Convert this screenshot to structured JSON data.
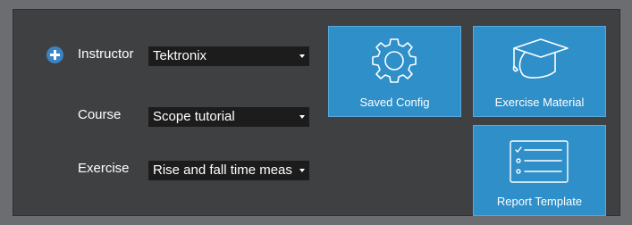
{
  "form": {
    "instructor": {
      "label": "Instructor",
      "value": "Tektronix"
    },
    "course": {
      "label": "Course",
      "value": "Scope tutorial"
    },
    "exercise": {
      "label": "Exercise",
      "value": "Rise and fall time meas"
    }
  },
  "tiles": {
    "saved_config": {
      "label": "Saved Config",
      "icon": "gear-icon"
    },
    "exercise_material": {
      "label": "Exercise Material",
      "icon": "graduation-cap-icon"
    },
    "report_template": {
      "label": "Report Template",
      "icon": "checklist-icon"
    }
  },
  "colors": {
    "accent": "#2f8fc9",
    "panel": "#3f4042",
    "dropdown": "#1c1c1c"
  }
}
